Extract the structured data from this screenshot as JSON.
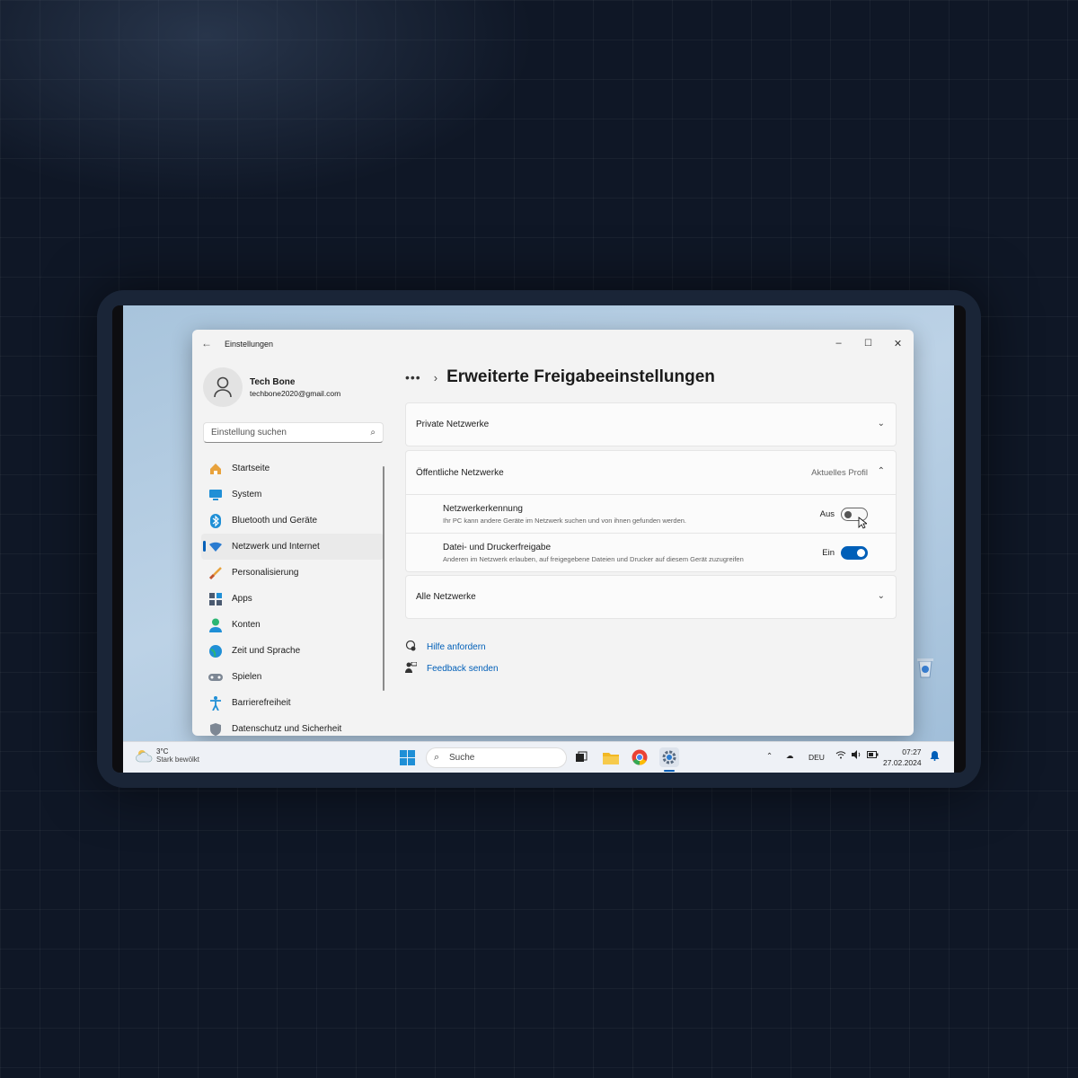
{
  "window": {
    "app_title": "Einstellungen",
    "minimize": "–",
    "maximize": "☐",
    "close": "✕"
  },
  "user": {
    "name": "Tech Bone",
    "email": "techbone2020@gmail.com"
  },
  "search": {
    "placeholder": "Einstellung suchen"
  },
  "sidebar": {
    "items": [
      {
        "label": "Startseite",
        "icon": "home-icon",
        "active": false
      },
      {
        "label": "System",
        "icon": "monitor-icon",
        "active": false
      },
      {
        "label": "Bluetooth und Geräte",
        "icon": "bluetooth-icon",
        "active": false
      },
      {
        "label": "Netzwerk und Internet",
        "icon": "wifi-icon",
        "active": true
      },
      {
        "label": "Personalisierung",
        "icon": "brush-icon",
        "active": false
      },
      {
        "label": "Apps",
        "icon": "apps-icon",
        "active": false
      },
      {
        "label": "Konten",
        "icon": "person-icon",
        "active": false
      },
      {
        "label": "Zeit und Sprache",
        "icon": "globe-clock-icon",
        "active": false
      },
      {
        "label": "Spielen",
        "icon": "gamepad-icon",
        "active": false
      },
      {
        "label": "Barrierefreiheit",
        "icon": "accessibility-icon",
        "active": false
      },
      {
        "label": "Datenschutz und Sicherheit",
        "icon": "shield-icon",
        "active": false
      }
    ]
  },
  "breadcrumb": {
    "ellipsis": "•••",
    "separator": "›",
    "title": "Erweiterte Freigabeeinstellungen"
  },
  "sections": {
    "private": {
      "label": "Private Netzwerke"
    },
    "public": {
      "label": "Öffentliche Netzwerke",
      "badge": "Aktuelles Profil",
      "settings": [
        {
          "title": "Netzwerkerkennung",
          "desc": "Ihr PC kann andere Geräte im Netzwerk suchen und von ihnen gefunden werden.",
          "state": "Aus",
          "on": false
        },
        {
          "title": "Datei- und Druckerfreigabe",
          "desc": "Anderen im Netzwerk erlauben, auf freigegebene Dateien und Drucker auf diesem Gerät zuzugreifen",
          "state": "Ein",
          "on": true
        }
      ]
    },
    "all": {
      "label": "Alle Netzwerke"
    }
  },
  "links": {
    "help": "Hilfe anfordern",
    "feedback": "Feedback senden"
  },
  "taskbar": {
    "temperature": "3°C",
    "weather": "Stark bewölkt",
    "search": "Suche",
    "language": "DEU",
    "time": "07:27",
    "date": "27.02.2024"
  },
  "colors": {
    "accent": "#005fb8",
    "window_bg": "#f3f3f3",
    "page_bg": "#0f1726"
  }
}
